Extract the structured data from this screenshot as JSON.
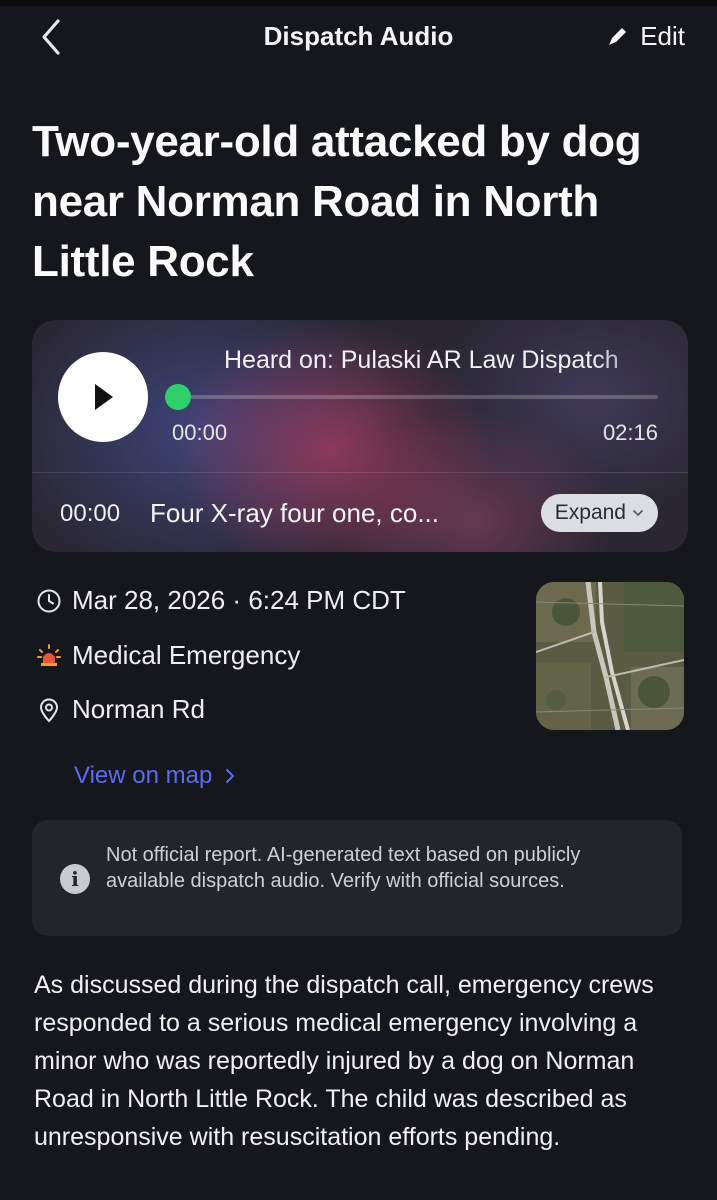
{
  "nav": {
    "title": "Dispatch Audio",
    "edit_label": "Edit"
  },
  "headline": "Two-year-old attacked by dog near Norman Road in North Little Rock",
  "audio": {
    "heard_on": "Heard on: Pulaski AR Law Dispatch",
    "current_time": "00:00",
    "duration": "02:16",
    "progress_fraction": 0,
    "transcript_time": "00:00",
    "transcript_text": "Four X-ray four one, co...",
    "expand_label": "Expand"
  },
  "meta": {
    "datetime": "Mar 28, 2026 · 6:24 PM CDT",
    "incident_type": "Medical Emergency",
    "location": "Norman Rd",
    "view_map_label": "View on map"
  },
  "disclaimer": "Not official report. AI-generated text based on publicly available dispatch audio. Verify with official sources.",
  "summary": "As discussed during the dispatch call, emergency crews responded to a serious medical emergency involving a minor who was reportedly injured by a dog on Norman Road in North Little Rock. The child was described as unresponsive with resuscitation efforts pending.",
  "colors": {
    "accent_green": "#2fd06a",
    "link_blue": "#5a6cf0",
    "background": "#16171c"
  },
  "icons": [
    "back-chevron-icon",
    "pencil-icon",
    "play-icon",
    "clock-icon",
    "siren-icon",
    "location-pin-icon",
    "chevron-right-icon",
    "chevron-down-icon",
    "info-icon"
  ]
}
